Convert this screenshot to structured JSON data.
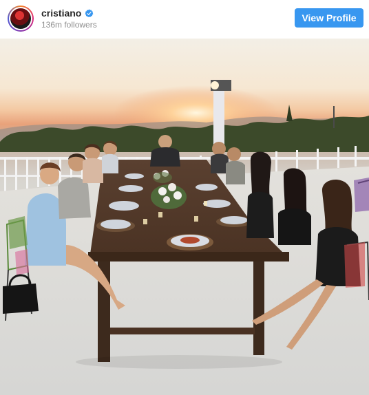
{
  "header": {
    "username": "cristiano",
    "followers": "136m followers",
    "view_profile_label": "View Profile",
    "verified_icon": "verified-badge-icon",
    "avatar_icon": "avatar"
  },
  "colors": {
    "accent": "#3897f0",
    "username": "#262626",
    "muted": "#8e8e8e",
    "verified": "#3897f0"
  },
  "photo": {
    "icon": "photo-dinner-sunset"
  }
}
